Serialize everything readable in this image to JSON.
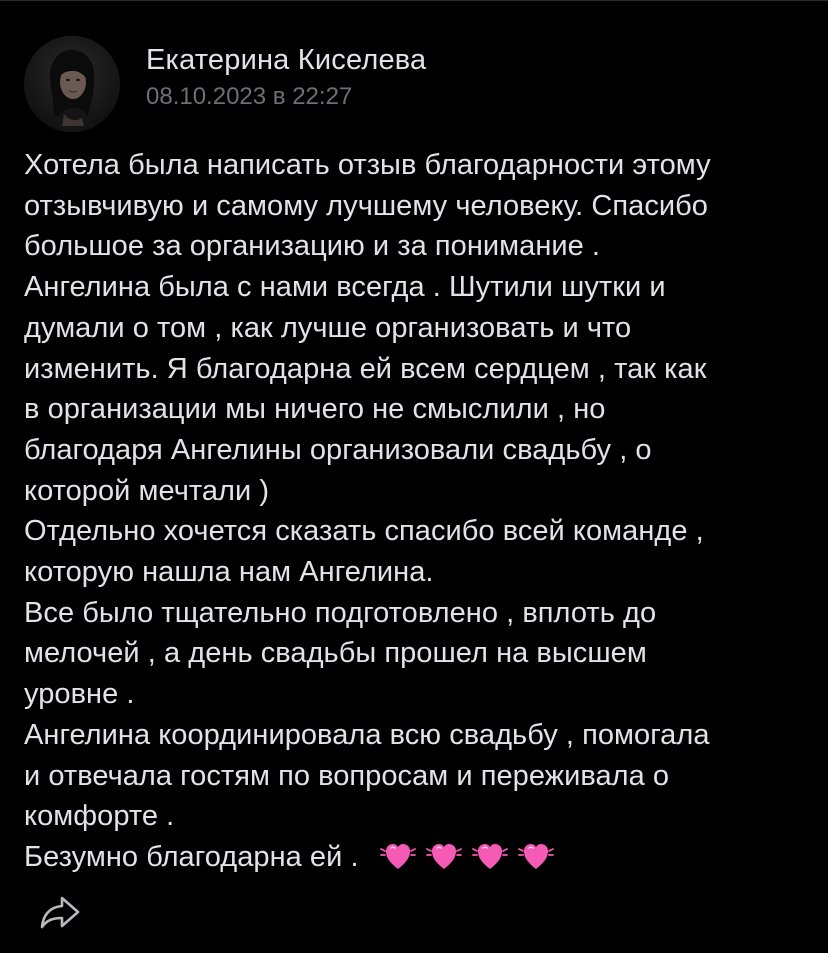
{
  "post": {
    "author": {
      "name": "Екатерина Киселева",
      "date": "08.10.2023 в 22:27"
    },
    "lines": [
      "Хотела была написать отзыв благодарности этому",
      "отзывчивую и самому лучшему человеку. Спасибо",
      "большое за организацию и за понимание .",
      "Ангелина была с нами всегда . Шутили шутки и",
      "думали о том , как лучше организовать и что",
      "изменить. Я благодарна ей всем сердцем , так как",
      "в организации мы ничего не смыслили , но",
      "благодаря Ангелины организовали свадьбу , о",
      "которой мечтали )",
      "Отдельно хочется сказать спасибо всей команде ,",
      "которую нашла нам Ангелина.",
      "Все было тщательно подготовлено , вплоть до",
      "мелочей , а день свадьбы прошел на высшем",
      "уровне .",
      "Ангелина координировала всю свадьбу , помогала",
      "и отвечала гостям по вопросам и переживала о",
      "комфорте .",
      "Безумно благодарна ей ."
    ],
    "hearts": [
      "vibrating-heart-icon",
      "vibrating-heart-icon",
      "vibrating-heart-icon",
      "vibrating-heart-icon"
    ]
  },
  "actions": {
    "share_icon": "share-arrow-icon"
  },
  "colors": {
    "background": "#000000",
    "text": "#e1e3e6",
    "secondary_text": "#6d6f73",
    "heart": "#f55ab5"
  }
}
